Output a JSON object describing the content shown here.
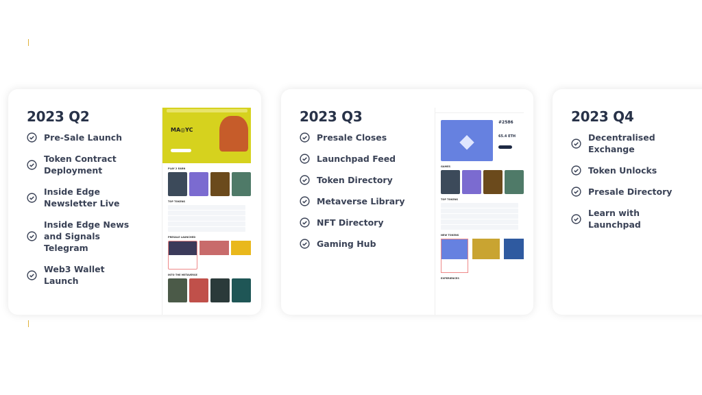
{
  "accent": "#e0b23a",
  "cards": [
    {
      "title": "2023 Q2",
      "items": [
        "Pre-Sale Launch",
        "Token Contract Deployment",
        "Inside Edge Newsletter Live",
        "Inside Edge News and Signals Telegram",
        "Web3 Wallet Launch"
      ],
      "mock": {
        "sections": [
          "PLAY 2 EARN",
          "TOP TOKENS",
          "PRESALE LAUNCHED",
          "INTO THE METAVERSE"
        ]
      }
    },
    {
      "title": "2023 Q3",
      "items": [
        "Presale Closes",
        "Launchpad Feed",
        "Token Directory",
        "Metaverse Library",
        "NFT Directory",
        "Gaming Hub"
      ],
      "mock": {
        "nft_id": "#2586",
        "price": "65.4 ETH",
        "sections": [
          "GAMES",
          "TOP TOKENS",
          "NEW TOKENS",
          "EXPERIENCES"
        ]
      }
    },
    {
      "title": "2023 Q4",
      "items": [
        "Decentralised Exchange",
        "Token Unlocks",
        "Presale Directory",
        "Learn with Launchpad"
      ]
    }
  ],
  "icons": {
    "item": "check-circle-icon"
  }
}
